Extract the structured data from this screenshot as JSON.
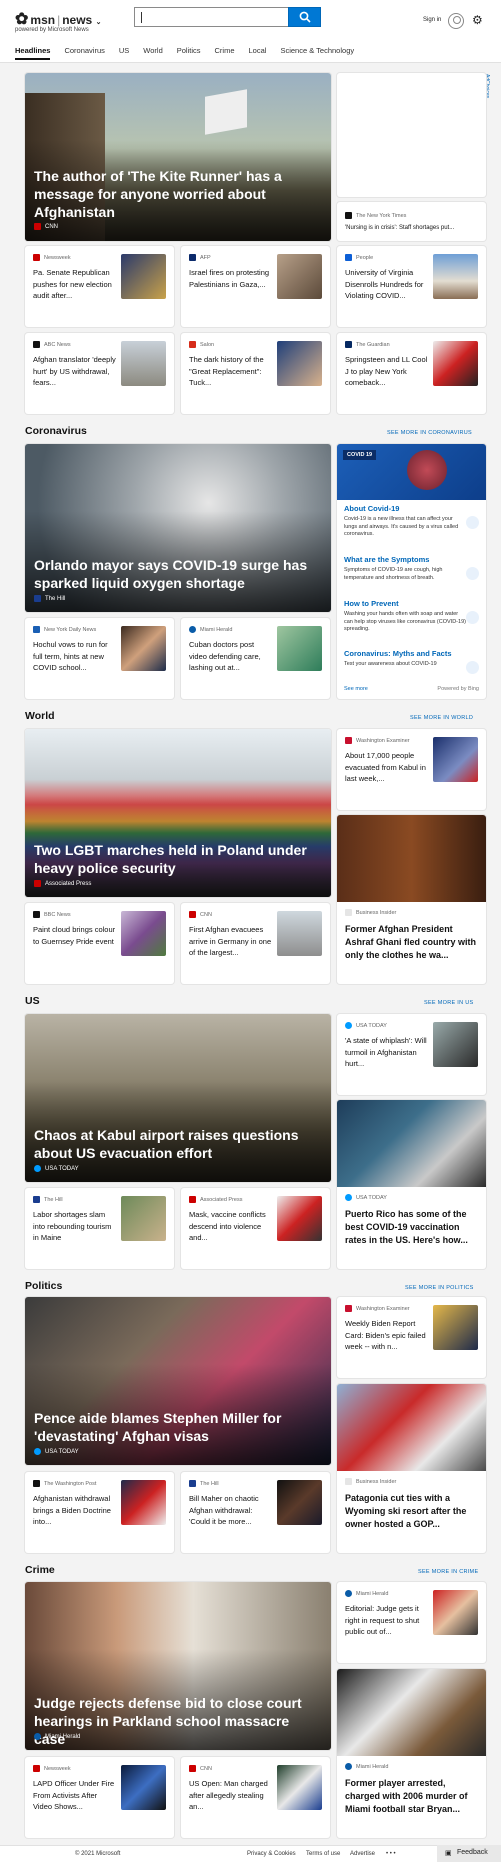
{
  "header": {
    "brand": "msn",
    "product": "news",
    "powered": "powered by Microsoft News",
    "search_value": "",
    "signin": "Sign in"
  },
  "nav": [
    "Headlines",
    "Coronavirus",
    "US",
    "World",
    "Politics",
    "Crime",
    "Local",
    "Science & Technology"
  ],
  "adchoices": "AdChoices",
  "headlines": {
    "hero": {
      "title": "The author of 'The Kite Runner' has a message for anyone worried about Afghanistan",
      "source": "CNN"
    },
    "side": {
      "source": "The New York Times",
      "title": "'Nursing is in crisis': Staff shortages put..."
    },
    "cards": [
      {
        "source": "Newsweek",
        "title": "Pa. Senate Republican pushes for new election audit after..."
      },
      {
        "source": "AFP",
        "title": "Israel fires on protesting Palestinians in Gaza,..."
      },
      {
        "source": "People",
        "title": "University of Virginia Disenrolls Hundreds for Violating COVID..."
      },
      {
        "source": "ABC News",
        "title": "Afghan translator 'deeply hurt' by US withdrawal, fears..."
      },
      {
        "source": "Salon",
        "title": "The dark history of the \"Great Replacement\": Tuck..."
      },
      {
        "source": "The Guardian",
        "title": "Springsteen and LL Cool J to play New York comeback..."
      }
    ]
  },
  "coronavirus": {
    "title": "Coronavirus",
    "see_more": "SEE MORE IN CORONAVIRUS",
    "hero": {
      "title": "Orlando mayor says COVID-19 surge has sparked liquid oxygen shortage",
      "source": "The Hill"
    },
    "cards": [
      {
        "source": "New York Daily News",
        "title": "Hochul vows to run for full term, hints at new COVID school..."
      },
      {
        "source": "Miami Herald",
        "title": "Cuban doctors post video defending care, lashing out at..."
      }
    ],
    "panel": {
      "label": "COVID 19",
      "items": [
        {
          "h": "About Covid-19",
          "d": "Covid-19 is a new illness that can affect your lungs and airways. It's caused by a virus called coronavirus."
        },
        {
          "h": "What are the Symptoms",
          "d": "Symptoms of COVID-19 are cough, high temperature and shortness of breath."
        },
        {
          "h": "How to Prevent",
          "d": "Washing your hands often with soap and water can help stop viruses like coronavirus (COVID-19) spreading."
        },
        {
          "h": "Coronavirus: Myths and Facts",
          "d": "Test your awareness about COVID-19"
        }
      ],
      "see_more": "See more",
      "powered": "Powered by Bing"
    }
  },
  "world": {
    "title": "World",
    "see_more": "SEE MORE IN WORLD",
    "hero": {
      "title": "Two LGBT marches held in Poland under heavy police security",
      "source": "Associated Press"
    },
    "side1": {
      "source": "Washington Examiner",
      "title": "About 17,000 people evacuated from Kabul in last week,..."
    },
    "side2": {
      "source": "Business Insider",
      "title": "Former Afghan President Ashraf Ghani fled country with only the clothes he wa..."
    },
    "cards": [
      {
        "source": "BBC News",
        "title": "Paint cloud brings colour to Guernsey Pride event"
      },
      {
        "source": "CNN",
        "title": "First Afghan evacuees arrive in Germany in one of the largest..."
      }
    ]
  },
  "us": {
    "title": "US",
    "see_more": "SEE MORE IN US",
    "hero": {
      "title": "Chaos at Kabul airport raises questions about US evacuation effort",
      "source": "USA TODAY"
    },
    "side1": {
      "source": "USA TODAY",
      "title": "'A state of whiplash': Will turmoil in Afghanistan hurt..."
    },
    "side2": {
      "source": "USA TODAY",
      "title": "Puerto Rico has some of the best COVID-19 vaccination rates in the US. Here's how..."
    },
    "cards": [
      {
        "source": "The Hill",
        "title": "Labor shortages slam into rebounding tourism in Maine"
      },
      {
        "source": "Associated Press",
        "title": "Mask, vaccine conflicts descend into violence and..."
      }
    ]
  },
  "politics": {
    "title": "Politics",
    "see_more": "SEE MORE IN POLITICS",
    "hero": {
      "title": "Pence aide blames Stephen Miller for 'devastating' Afghan visas",
      "source": "USA TODAY"
    },
    "side1": {
      "source": "Washington Examiner",
      "title": "Weekly Biden Report Card: Biden's epic failed week -- with n..."
    },
    "side2": {
      "source": "Business Insider",
      "title": "Patagonia cut ties with a Wyoming ski resort after the owner hosted a GOP..."
    },
    "cards": [
      {
        "source": "The Washington Post",
        "title": "Afghanistan withdrawal brings a Biden Doctrine into..."
      },
      {
        "source": "The Hill",
        "title": "Bill Maher on chaotic Afghan withdrawal: 'Could it be more..."
      }
    ]
  },
  "crime": {
    "title": "Crime",
    "see_more": "SEE MORE IN CRIME",
    "hero": {
      "title": "Judge rejects defense bid to close court hearings in Parkland school massacre case",
      "source": "Miami Herald"
    },
    "side1": {
      "source": "Miami Herald",
      "title": "Editorial: Judge gets it right in request to shut public out of..."
    },
    "side2": {
      "source": "Miami Herald",
      "title": "Former player arrested, charged with 2006 murder of Miami football star Bryan..."
    },
    "cards": [
      {
        "source": "Newsweek",
        "title": "LAPD Officer Under Fire From Activists After Video Shows..."
      },
      {
        "source": "CNN",
        "title": "US Open: Man charged after allegedly stealing an..."
      }
    ]
  },
  "footer": {
    "copyright": "© 2021 Microsoft",
    "privacy": "Privacy & Cookies",
    "terms": "Terms of use",
    "advertise": "Advertise",
    "more": "• • •",
    "feedback": "Feedback"
  }
}
